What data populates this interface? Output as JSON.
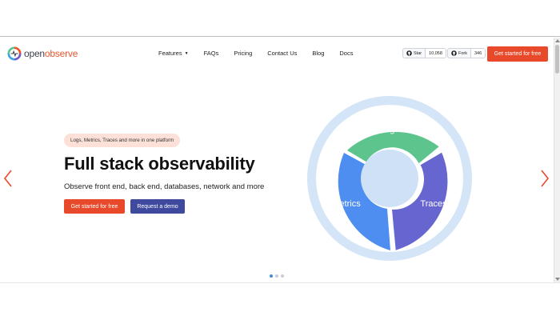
{
  "logo": {
    "part1": "open",
    "part2": "observe"
  },
  "nav": {
    "items": [
      {
        "label": "Features",
        "has_dropdown": true
      },
      {
        "label": "FAQs"
      },
      {
        "label": "Pricing"
      },
      {
        "label": "Contact Us"
      },
      {
        "label": "Blog"
      },
      {
        "label": "Docs"
      }
    ],
    "caret": "▼"
  },
  "github": {
    "star_label": "Star",
    "star_count": "10,058",
    "fork_label": "Fork",
    "fork_count": "346"
  },
  "cta_nav": "Get started for free",
  "hero": {
    "pill": "Logs, Metrics, Traces and more in one platform",
    "title": "Full stack observability",
    "subtitle": "Observe front end, back end, databases, network and more",
    "primary_button": "Get started for free",
    "secondary_button": "Request a demo"
  },
  "wheel": {
    "segments": [
      {
        "label": "Logs",
        "color": "#5cc48c"
      },
      {
        "label": "Traces",
        "color": "#6766d0"
      },
      {
        "label": "Metrics",
        "color": "#4e8ef0"
      }
    ],
    "ring_color": "#d4e5f7",
    "center_color": "#cfe1f6"
  },
  "carousel": {
    "slides": 3,
    "active": 0
  },
  "colors": {
    "accent": "#e8492a",
    "secondary": "#3f4a9e",
    "arrow": "#e8492a"
  }
}
